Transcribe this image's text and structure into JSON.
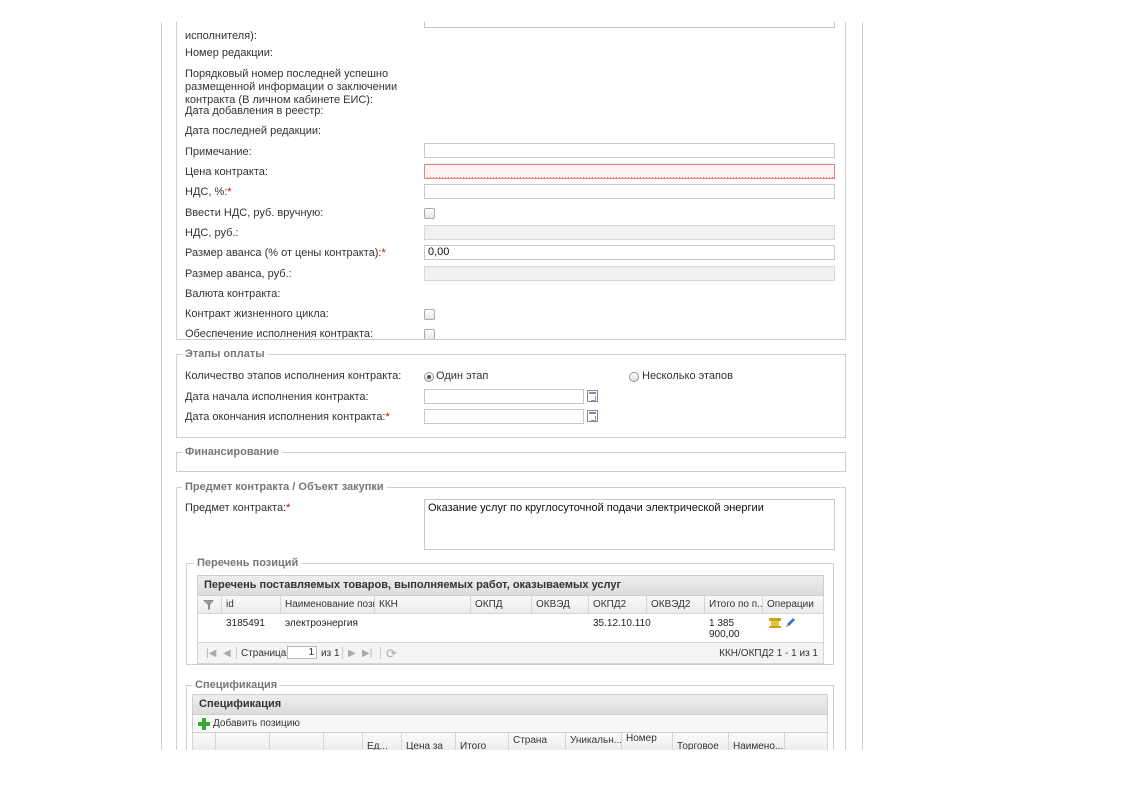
{
  "contract": {
    "executor_label_tail": "исполнителя):",
    "edition_number_label": "Номер редакции:",
    "last_info_number_label": "Порядковый номер последней успешно размещенной информации о заключении контракта (В личном кабинете ЕИС):",
    "date_added_label": "Дата добавления в реестр:",
    "date_last_edit_label": "Дата последней редакции:",
    "note_label": "Примечание:",
    "note_value": "",
    "price_label": "Цена контракта:",
    "price_value": "",
    "vat_pct_label": "НДС, %:",
    "vat_pct_value": "",
    "vat_manual_label": "Ввести НДС, руб. вручную:",
    "vat_rub_label": "НДС, руб.:",
    "vat_rub_value": "",
    "advance_pct_label": "Размер аванса (% от цены контракта):",
    "advance_pct_value": "0,00",
    "advance_rub_label": "Размер аванса, руб.:",
    "advance_rub_value": "",
    "currency_label": "Валюта контракта:",
    "lifecycle_label": "Контракт жизненного цикла:",
    "guarantee_label": "Обеспечение исполнения контракта:",
    "required_mark": "*"
  },
  "payment": {
    "legend": "Этапы оплаты",
    "stages_label": "Количество этапов исполнения контракта:",
    "option_one": "Один этап",
    "option_many": "Несколько этапов",
    "start_label": "Дата начала исполнения контракта:",
    "start_value": "",
    "end_label": "Дата окончания исполнения контракта:",
    "end_value": ""
  },
  "financing": {
    "legend": "Финансирование"
  },
  "subject": {
    "legend": "Предмет контракта / Объект закупки",
    "subject_label": "Предмет контракта:",
    "subject_value": "Оказание услуг по круглосуточной подачи электрической энергии"
  },
  "positions": {
    "legend": "Перечень позиций",
    "grid_title": "Перечень поставляемых товаров, выполняемых работ, оказываемых услуг",
    "columns": [
      "id",
      "Наименование пози...",
      "ККН",
      "ОКПД",
      "ОКВЭД",
      "ОКПД2",
      "ОКВЭД2",
      "Итого по п...",
      "Операции"
    ],
    "rows": [
      {
        "id": "3185491",
        "name": "электроэнергия",
        "kkn": "",
        "okpd": "",
        "okved": "",
        "okpd2": "35.12.10.110",
        "okved2": "",
        "total_line1": "1 385",
        "total_line2": "900,00"
      }
    ],
    "pager": {
      "page_label": "Страница",
      "page_value": "1",
      "of_label": "из 1",
      "summary": "ККН/ОКПД2 1 - 1 из 1"
    }
  },
  "spec": {
    "legend": "Спецификация",
    "grid_title": "Спецификация",
    "add_label": "Добавить позицию",
    "columns": [
      "",
      "",
      "",
      "Ед...",
      "Цена за",
      "Итого",
      "Страна",
      "Уникальн...",
      "Номер",
      "Торговое",
      "Наимено..."
    ]
  },
  "colors": {
    "required": "#e00000",
    "invalid_border": "#e98080",
    "add_icon": "#3aa935"
  }
}
